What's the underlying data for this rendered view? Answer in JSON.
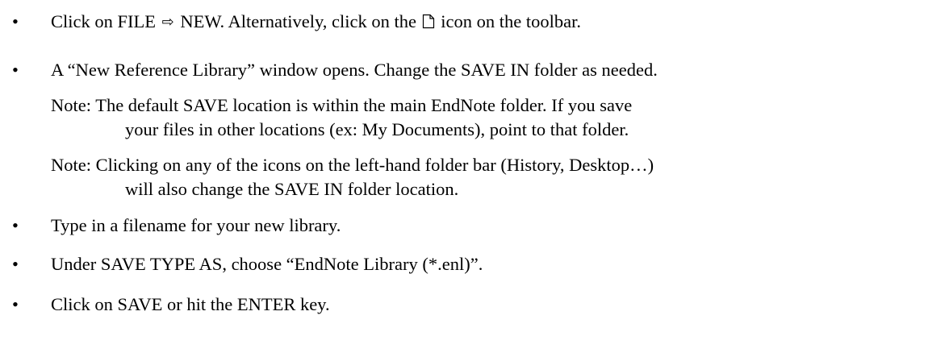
{
  "instructions": [
    {
      "bullet": "•",
      "pre_arrow": "Click on FILE",
      "arrow": "⇨",
      "post_arrow": "NEW.  Alternatively, click on the",
      "icon": "new-document-icon",
      "post_icon": "icon on the toolbar."
    },
    {
      "bullet": "•",
      "text": "A “New Reference Library” window opens.  Change the SAVE IN folder as needed."
    },
    {
      "note": "Note:  The default SAVE location is within the main EndNote folder.  If you save",
      "note_continuation": "your files in other locations (ex: My Documents), point to that folder."
    },
    {
      "note": "Note:   Clicking on any of the icons on the left-hand folder bar (History, Desktop…)",
      "note_continuation": "will also change the SAVE IN folder location."
    },
    {
      "bullet": "•",
      "text": "Type in a filename for your new library."
    },
    {
      "bullet": "•",
      "text": "Under SAVE TYPE AS, choose “EndNote Library (*.enl)”."
    },
    {
      "bullet": "•",
      "text": "Click on SAVE or hit the ENTER key."
    }
  ]
}
